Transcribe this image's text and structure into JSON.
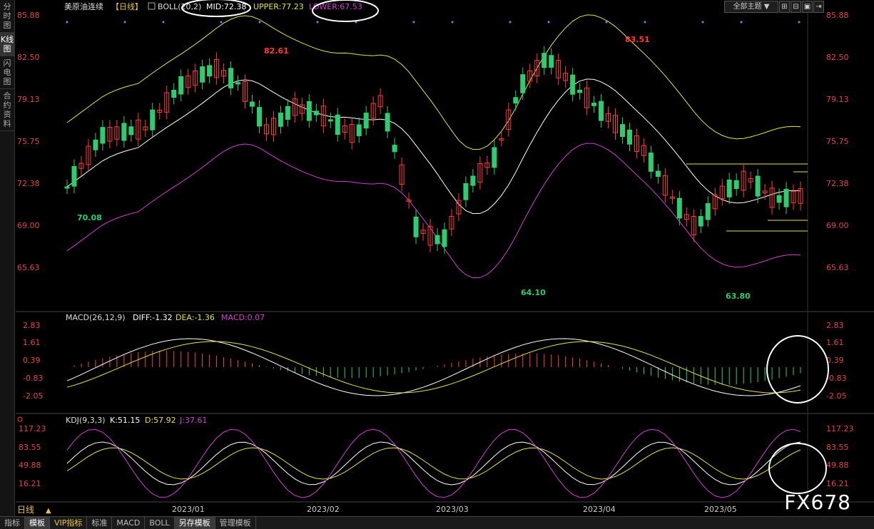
{
  "side_tabs": [
    "分时图",
    "K线图",
    "闪电图",
    "合约资料"
  ],
  "main": {
    "title": "美原油连续",
    "period_tag": "【日线】",
    "boll": {
      "label": "BOLL(20,2)",
      "mid": "MID:72.38",
      "upper": "UPPER:77.23",
      "lower": "LOWER:67.53"
    },
    "y_labels": [
      "85.88",
      "82.50",
      "79.13",
      "75.75",
      "72.38",
      "69.00",
      "65.63"
    ],
    "annotations": {
      "high1": "82.61",
      "high2": "83.51",
      "low1": "70.08",
      "low2": "64.10",
      "low3": "63.80"
    },
    "colors": {
      "up": "#ff3b3b",
      "down": "#2ecc71",
      "mid": "#ffffff",
      "upper": "#e6e24a",
      "lower": "#d040d0"
    }
  },
  "macd": {
    "label": "MACD(26,12,9)",
    "diff": "DIFF:-1.32",
    "dea": "DEA:-1.36",
    "macd": "MACD:0.07",
    "y_labels": [
      "2.83",
      "1.61",
      "0.39",
      "-0.83",
      "-2.05"
    ]
  },
  "kdj": {
    "label": "KDJ(9,3,3)",
    "k": "K:51.15",
    "d": "D:57.92",
    "j": "J:37.61",
    "y_labels": [
      "117.23",
      "83.55",
      "49.88",
      "16.21"
    ]
  },
  "toolbar": {
    "theme": "全部主题"
  },
  "x_axis": {
    "period": "日线",
    "months": [
      "2023/01",
      "2023/02",
      "2023/03",
      "2023/04",
      "2023/05"
    ]
  },
  "bottom_tabs": [
    "指标",
    "模板",
    "VIP指标",
    "标准",
    "MACD",
    "BOLL",
    "另存模板",
    "管理模板"
  ],
  "watermark": "FX678"
}
